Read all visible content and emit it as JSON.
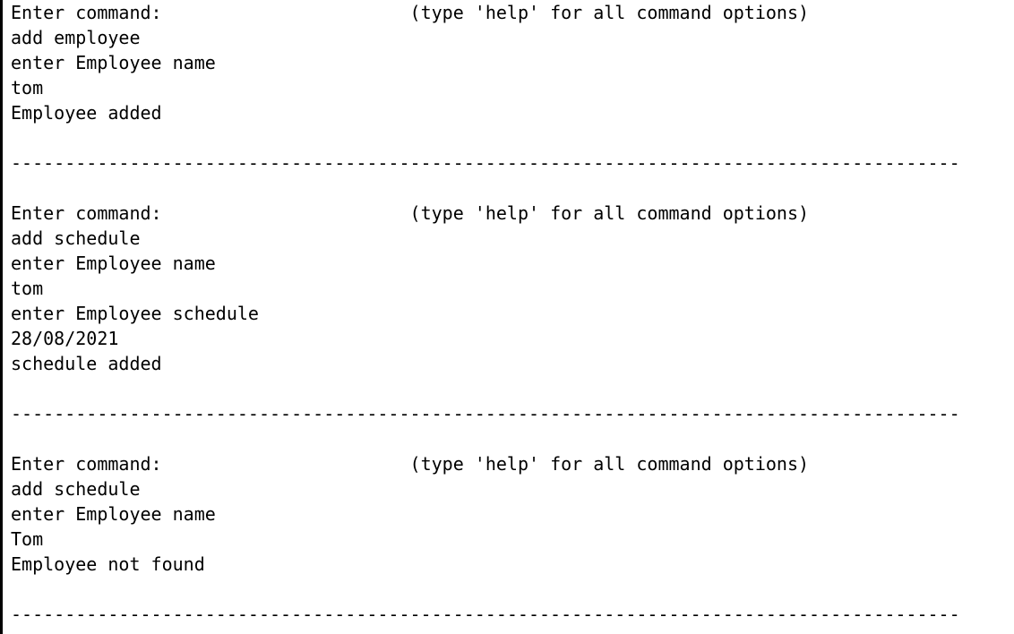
{
  "app": {
    "type": "console",
    "background_color": "#ffffff",
    "text_color": "#000000",
    "border_color": "#000000"
  },
  "console": {
    "prompt_label": "Enter command:",
    "hint_text": "(type 'help' for all command options)",
    "prompt_hint_column": 37,
    "separator_char": "-",
    "separator_length": 88,
    "separator": "----------------------------------------------------------------------------------------",
    "blocks": [
      {
        "id": "block-1-add-employee",
        "prompt": {
          "label": "Enter command:",
          "hint": "(type 'help' for all command options)",
          "full": "Enter command:                       (type 'help' for all command options)"
        },
        "lines": [
          {
            "kind": "user-input",
            "text": "add employee"
          },
          {
            "kind": "program-prompt",
            "text": "enter Employee name"
          },
          {
            "kind": "user-input",
            "text": "tom"
          },
          {
            "kind": "program-result",
            "text": "Employee added"
          }
        ]
      },
      {
        "id": "block-2-add-schedule-success",
        "prompt": {
          "label": "Enter command:",
          "hint": "(type 'help' for all command options)",
          "full": "Enter command:                       (type 'help' for all command options)"
        },
        "lines": [
          {
            "kind": "user-input",
            "text": "add schedule"
          },
          {
            "kind": "program-prompt",
            "text": "enter Employee name"
          },
          {
            "kind": "user-input",
            "text": "tom"
          },
          {
            "kind": "program-prompt",
            "text": "enter Employee schedule"
          },
          {
            "kind": "user-input",
            "text": "28/08/2021"
          },
          {
            "kind": "program-result",
            "text": "schedule added"
          }
        ]
      },
      {
        "id": "block-3-add-schedule-not-found",
        "prompt": {
          "label": "Enter command:",
          "hint": "(type 'help' for all command options)",
          "full": "Enter command:                       (type 'help' for all command options)"
        },
        "lines": [
          {
            "kind": "user-input",
            "text": "add schedule"
          },
          {
            "kind": "program-prompt",
            "text": "enter Employee name"
          },
          {
            "kind": "user-input",
            "text": "Tom"
          },
          {
            "kind": "program-result",
            "text": "Employee not found"
          }
        ]
      }
    ]
  }
}
